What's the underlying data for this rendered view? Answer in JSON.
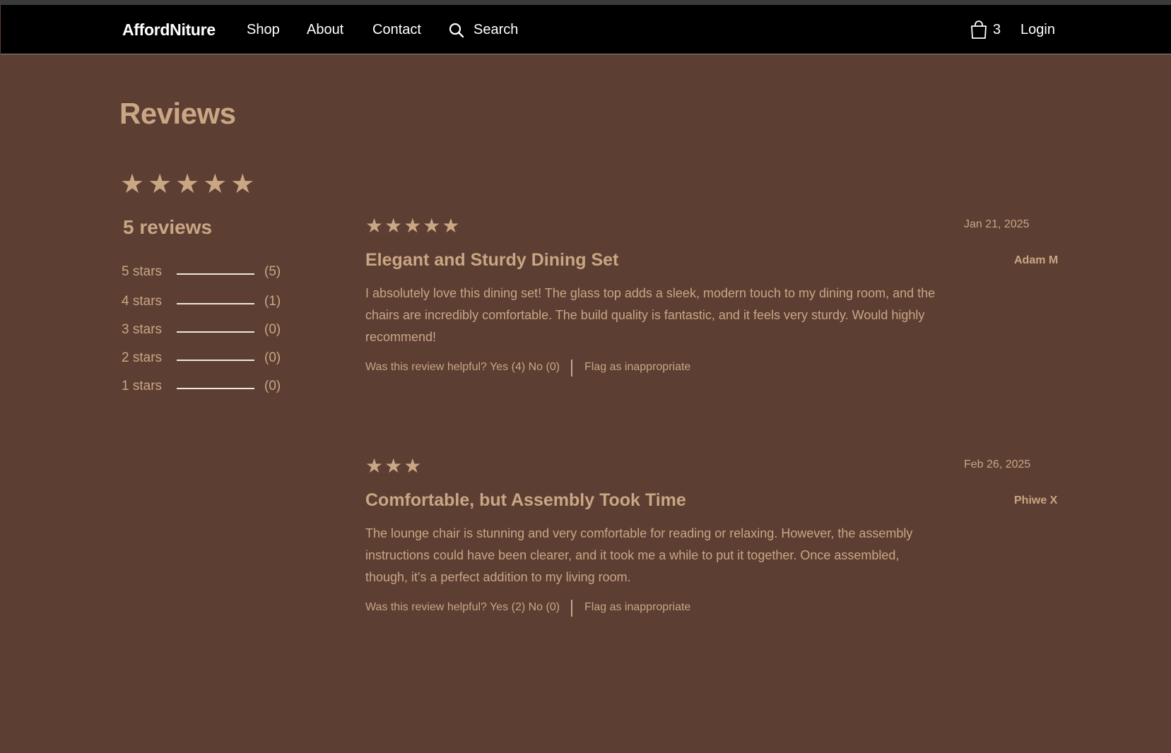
{
  "nav": {
    "logo": "AffordNiture",
    "shop": "Shop",
    "about": "About",
    "contact": "Contact",
    "search": "Search",
    "cart_count": "3",
    "login": "Login"
  },
  "page": {
    "title": "Reviews"
  },
  "summary": {
    "stars": "★★★★★",
    "count_label": "5 reviews",
    "histogram": [
      {
        "label": "5 stars",
        "count": "(5)"
      },
      {
        "label": "4 stars",
        "count": "(1)"
      },
      {
        "label": "3 stars",
        "count": "(0)"
      },
      {
        "label": "2 stars",
        "count": "(0)"
      },
      {
        "label": "1 stars",
        "count": "(0)"
      }
    ]
  },
  "reviews": [
    {
      "stars": "★★★★★",
      "date": "Jan 21, 2025",
      "title": "Elegant and Sturdy Dining Set",
      "author": "Adam M",
      "body": "I absolutely love this dining set! The glass top adds a sleek, modern touch to my dining room, and the chairs are incredibly comfortable. The build quality is fantastic, and it feels very sturdy. Would highly recommend!",
      "helpful": "Was this review helpful? Yes (4) No (0)",
      "flag": "Flag as inappropriate"
    },
    {
      "stars": "★★★",
      "date": "Feb 26, 2025",
      "title": "Comfortable, but Assembly Took Time",
      "author": "Phiwe X",
      "body": "The lounge chair is stunning and very comfortable for reading or relaxing. However, the assembly instructions could have been clearer, and it took me a while to put it together. Once assembled, though, it's a perfect addition to my living room.",
      "helpful": "Was this review helpful? Yes (2) No (0)",
      "flag": "Flag as inappropriate"
    }
  ]
}
